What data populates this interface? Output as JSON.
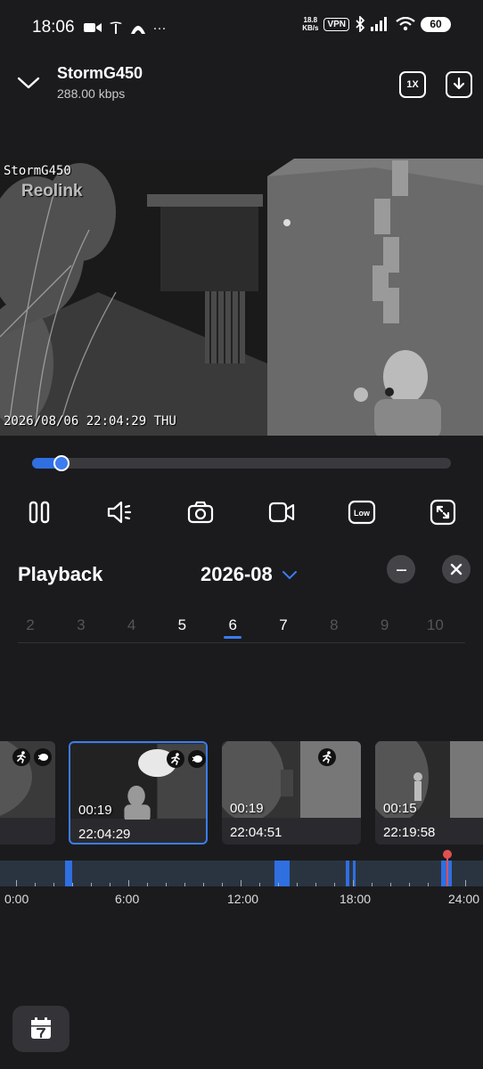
{
  "status": {
    "time": "18:06",
    "net_speed_value": "18.8",
    "net_speed_unit": "KB/s",
    "vpn": "VPN",
    "battery": "60",
    "left_icons": [
      "video-camera-icon",
      "tesla-icon",
      "arch-icon",
      "more-dots-icon"
    ],
    "extra_dots": "···"
  },
  "header": {
    "camera_name": "StormG450",
    "bitrate": "288.00 kbps",
    "speed": "1X"
  },
  "video": {
    "osd_name": "StormG450",
    "osd_brand": "Reolink",
    "osd_timestamp": "2026/08/06 22:04:29 THU",
    "progress": 0.05
  },
  "controls": [
    "pause-icon",
    "volume-icon",
    "snapshot-icon",
    "record-icon",
    "quality-low-icon",
    "fullscreen-icon"
  ],
  "quality_label": "Low",
  "playback": {
    "title": "Playback",
    "month": "2026-08",
    "more": "---",
    "days": [
      {
        "label": "2",
        "has_recordings": false
      },
      {
        "label": "3",
        "has_recordings": false
      },
      {
        "label": "4",
        "has_recordings": false
      },
      {
        "label": "5",
        "has_recordings": true
      },
      {
        "label": "6",
        "has_recordings": true,
        "selected": true
      },
      {
        "label": "7",
        "has_recordings": true
      },
      {
        "label": "8",
        "has_recordings": false
      },
      {
        "label": "9",
        "has_recordings": false
      },
      {
        "label": "10",
        "has_recordings": false
      }
    ]
  },
  "clips": [
    {
      "duration": "",
      "time": "",
      "selected": false,
      "badges": [
        "motion-icon",
        "light-icon"
      ]
    },
    {
      "duration": "00:19",
      "time": "22:04:29",
      "selected": true,
      "badges": [
        "motion-icon",
        "light-icon"
      ]
    },
    {
      "duration": "00:19",
      "time": "22:04:51",
      "selected": false,
      "badges": [
        "motion-icon"
      ]
    },
    {
      "duration": "00:15",
      "time": "22:19:58",
      "selected": false,
      "badges": []
    }
  ],
  "timeline": {
    "labels": [
      "0:00",
      "6:00",
      "12:00",
      "18:00",
      "24:00"
    ],
    "segments_hours": [
      [
        2.6,
        3.0
      ],
      [
        13.8,
        14.6
      ],
      [
        17.6,
        17.8
      ],
      [
        18.0,
        18.1
      ],
      [
        22.7,
        23.3
      ]
    ],
    "current_hour": 23.07
  }
}
